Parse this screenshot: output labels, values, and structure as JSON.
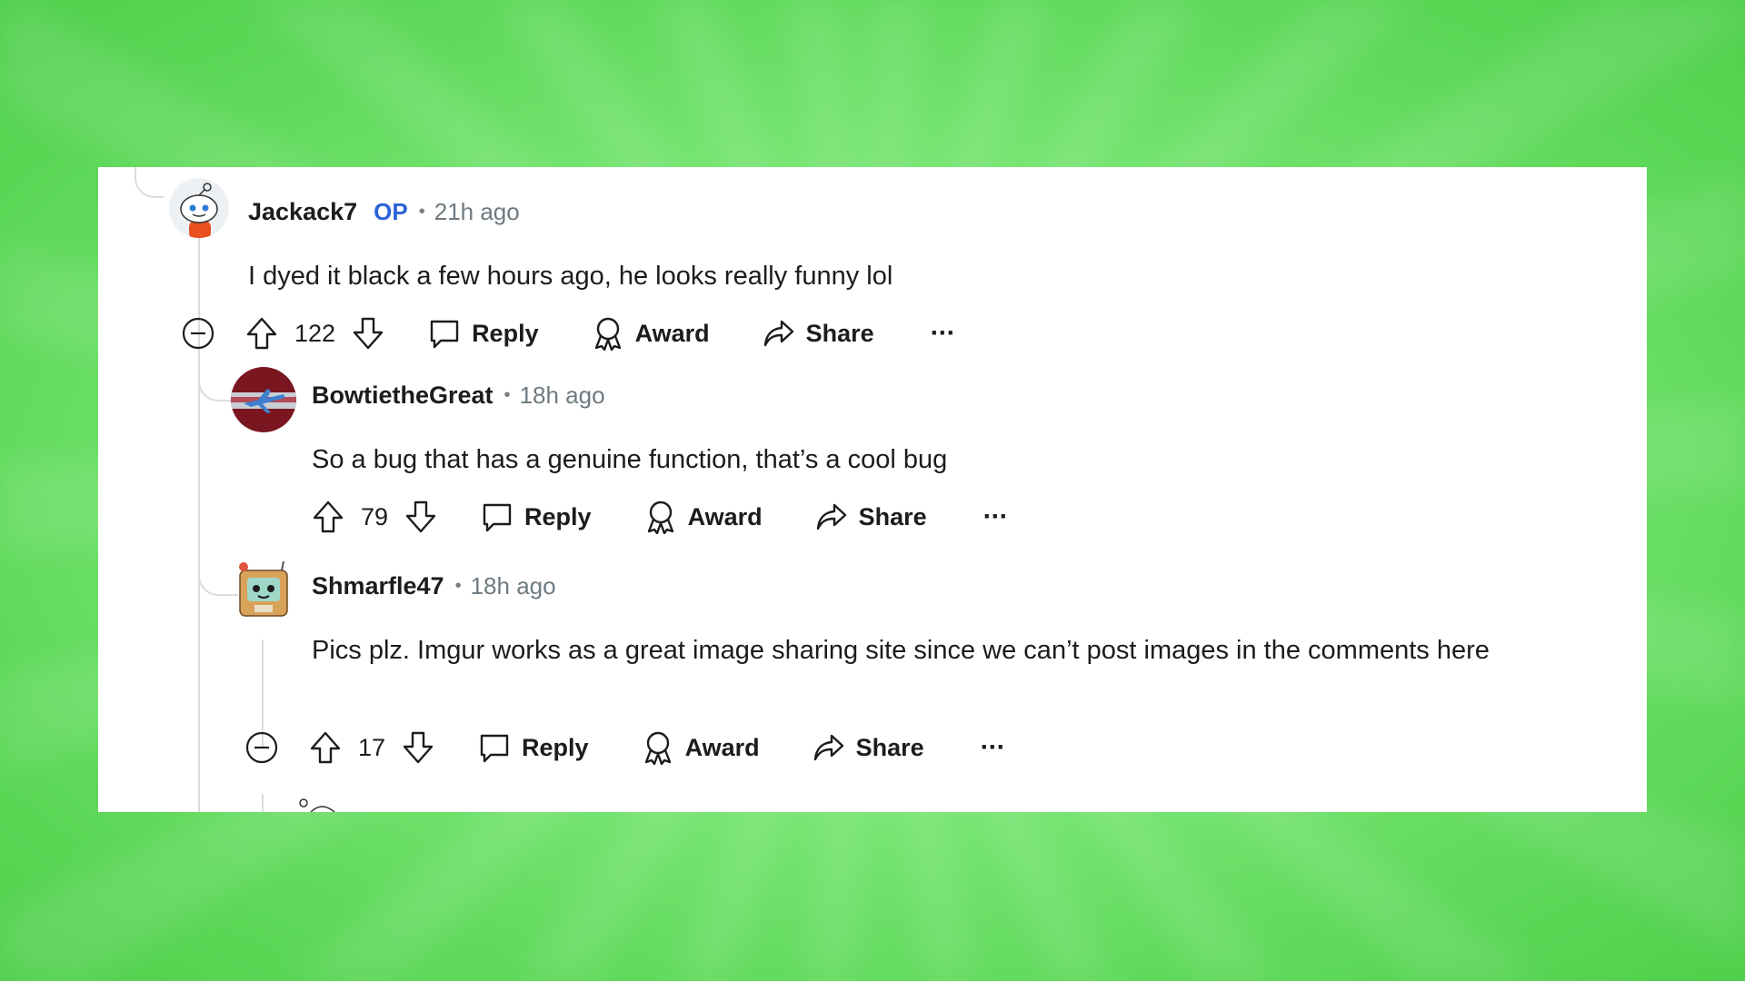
{
  "comments": [
    {
      "username": "Jackack7",
      "op_badge": "OP",
      "separator": "•",
      "time": "21h ago",
      "text": "I dyed it black a few hours ago, he looks really funny lol",
      "score": "122",
      "reply_label": "Reply",
      "award_label": "Award",
      "share_label": "Share",
      "more_label": "···"
    },
    {
      "username": "BowtietheGreat",
      "separator": "•",
      "time": "18h ago",
      "text": "So a bug that has a genuine function, that’s a cool bug",
      "score": "79",
      "reply_label": "Reply",
      "award_label": "Award",
      "share_label": "Share",
      "more_label": "···"
    },
    {
      "username": "Shmarfle47",
      "separator": "•",
      "time": "18h ago",
      "text": "Pics plz. Imgur works as a great image sharing site since we can’t post images in the comments here",
      "score": "17",
      "reply_label": "Reply",
      "award_label": "Award",
      "share_label": "Share",
      "more_label": "···"
    }
  ],
  "colors": {
    "background": "#7ee87a",
    "card": "#ffffff",
    "op_badge": "#2a64d6",
    "meta_text": "#6f7a80",
    "thread_line": "#d9dde0"
  },
  "icons": [
    "collapse-icon",
    "upvote-icon",
    "downvote-icon",
    "reply-icon",
    "award-icon",
    "share-icon",
    "more-icon"
  ]
}
